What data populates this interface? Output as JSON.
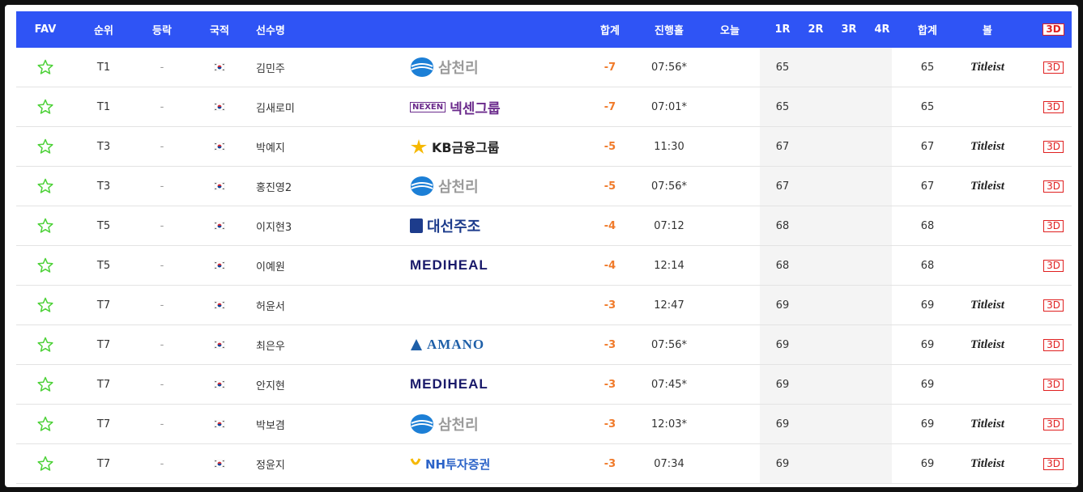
{
  "header": {
    "fav": "FAV",
    "rank": "순위",
    "move": "등락",
    "nationality": "국적",
    "player": "선수명",
    "total": "합계",
    "thru": "진행홀",
    "today": "오늘",
    "r1": "1R",
    "r2": "2R",
    "r3": "3R",
    "r4": "4R",
    "sum": "합계",
    "ball": "볼",
    "btn3d": "3D"
  },
  "colors": {
    "header_bg": "#2f54f5",
    "score": "#f07a2a",
    "btn3d": "#e02020",
    "star": "#4cd137"
  },
  "rows": [
    {
      "rank": "T1",
      "move": "-",
      "flag": "kr-flag",
      "name": "김민주",
      "sponsor": "삼천리",
      "total": "-7",
      "thru": "07:56*",
      "r1": "65",
      "sum": "65",
      "ball": "Titleist",
      "btn": "3D"
    },
    {
      "rank": "T1",
      "move": "-",
      "flag": "kr-flag",
      "name": "김새로미",
      "sponsor": "넥센그룹",
      "sponsor_mark": "NEXEN",
      "total": "-7",
      "thru": "07:01*",
      "r1": "65",
      "sum": "65",
      "ball": "",
      "btn": "3D"
    },
    {
      "rank": "T3",
      "move": "-",
      "flag": "kr-flag",
      "name": "박예지",
      "sponsor": "KB금융그룹",
      "total": "-5",
      "thru": "11:30",
      "r1": "67",
      "sum": "67",
      "ball": "Titleist",
      "btn": "3D"
    },
    {
      "rank": "T3",
      "move": "-",
      "flag": "kr-flag",
      "name": "홍진영2",
      "sponsor": "삼천리",
      "total": "-5",
      "thru": "07:56*",
      "r1": "67",
      "sum": "67",
      "ball": "Titleist",
      "btn": "3D"
    },
    {
      "rank": "T5",
      "move": "-",
      "flag": "kr-flag",
      "name": "이지현3",
      "sponsor": "대선주조",
      "total": "-4",
      "thru": "07:12",
      "r1": "68",
      "sum": "68",
      "ball": "",
      "btn": "3D"
    },
    {
      "rank": "T5",
      "move": "-",
      "flag": "kr-flag",
      "name": "이예원",
      "sponsor": "MEDIHEAL",
      "total": "-4",
      "thru": "12:14",
      "r1": "68",
      "sum": "68",
      "ball": "",
      "btn": "3D"
    },
    {
      "rank": "T7",
      "move": "-",
      "flag": "kr-flag",
      "name": "허윤서",
      "sponsor": "",
      "total": "-3",
      "thru": "12:47",
      "r1": "69",
      "sum": "69",
      "ball": "Titleist",
      "btn": "3D"
    },
    {
      "rank": "T7",
      "move": "-",
      "flag": "kr-flag",
      "name": "최은우",
      "sponsor": "AMANO",
      "total": "-3",
      "thru": "07:56*",
      "r1": "69",
      "sum": "69",
      "ball": "Titleist",
      "btn": "3D"
    },
    {
      "rank": "T7",
      "move": "-",
      "flag": "kr-flag",
      "name": "안지현",
      "sponsor": "MEDIHEAL",
      "total": "-3",
      "thru": "07:45*",
      "r1": "69",
      "sum": "69",
      "ball": "",
      "btn": "3D"
    },
    {
      "rank": "T7",
      "move": "-",
      "flag": "kr-flag",
      "name": "박보겸",
      "sponsor": "삼천리",
      "total": "-3",
      "thru": "12:03*",
      "r1": "69",
      "sum": "69",
      "ball": "Titleist",
      "btn": "3D"
    },
    {
      "rank": "T7",
      "move": "-",
      "flag": "kr-flag",
      "name": "정윤지",
      "sponsor": "NH투자증권",
      "total": "-3",
      "thru": "07:34",
      "r1": "69",
      "sum": "69",
      "ball": "Titleist",
      "btn": "3D"
    }
  ]
}
